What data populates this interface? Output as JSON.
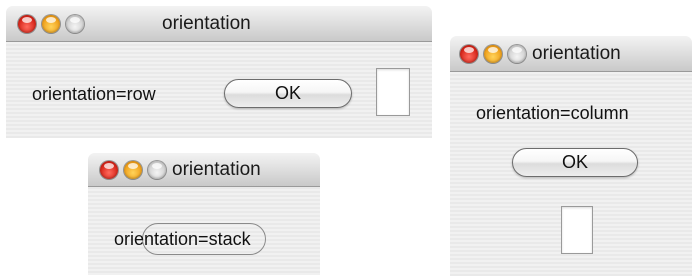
{
  "windows": {
    "row": {
      "title": "orientation",
      "label": "orientation=row",
      "button": "OK"
    },
    "column": {
      "title": "orientation",
      "label": "orientation=column",
      "button": "OK"
    },
    "stack": {
      "title": "orientation",
      "label": "orientation=stack"
    }
  },
  "colors": {
    "close": "#d7261a",
    "minimize": "#f0a11c",
    "zoom": "#c8c8c8"
  }
}
